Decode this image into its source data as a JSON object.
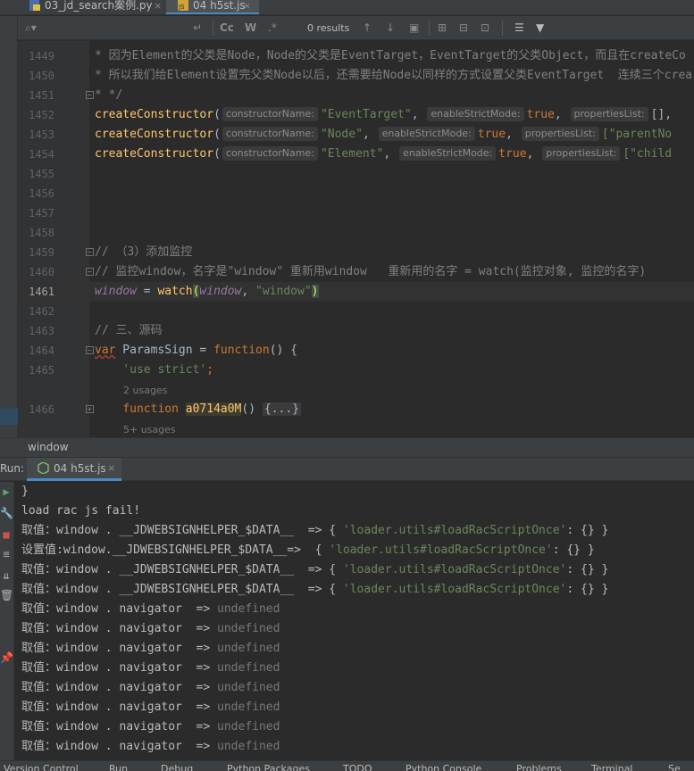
{
  "tabs": [
    {
      "label": "03_jd_search案例.py",
      "icon": "python-file-icon"
    },
    {
      "label": "04 h5st.js",
      "icon": "js-file-icon",
      "active": true
    }
  ],
  "search": {
    "placeholder": "",
    "results": "0 results",
    "match_case": "Cc",
    "words": "W",
    "regex": ".*"
  },
  "editor": {
    "lines": [
      {
        "num": "1449",
        "segments": [
          {
            "t": "* 因为Element的父类是Node，Node的父类是EventTarget，EventTarget的父类Object，而且在createCo",
            "c": "comment"
          }
        ]
      },
      {
        "num": "1450",
        "segments": [
          {
            "t": "* 所以我们给Element设置完父类Node以后，还需要给Node以同样的方式设置父类EventTarget  连续三个crea",
            "c": "comment"
          }
        ]
      },
      {
        "num": "1451",
        "segments": [
          {
            "t": "* */",
            "c": "comment"
          }
        ]
      },
      {
        "num": "1452",
        "segments": [
          {
            "t": "createConstructor",
            "c": "fn"
          },
          {
            "t": "(",
            "c": ""
          },
          {
            "hint": "constructorName:"
          },
          {
            "t": "\"EventTarget\"",
            "c": "str"
          },
          {
            "t": ", ",
            "c": ""
          },
          {
            "hint": "enableStrictMode:"
          },
          {
            "t": "true",
            "c": "kw"
          },
          {
            "t": ", ",
            "c": ""
          },
          {
            "hint": "propertiesList:"
          },
          {
            "t": "[],",
            "c": ""
          }
        ]
      },
      {
        "num": "1453",
        "segments": [
          {
            "t": "createConstructor",
            "c": "fn"
          },
          {
            "t": "(",
            "c": ""
          },
          {
            "hint": "constructorName:"
          },
          {
            "t": "\"Node\"",
            "c": "str"
          },
          {
            "t": ", ",
            "c": ""
          },
          {
            "hint": "enableStrictMode:"
          },
          {
            "t": "true",
            "c": "kw"
          },
          {
            "t": ", ",
            "c": ""
          },
          {
            "hint": "propertiesList:"
          },
          {
            "t": "[\"parentNo",
            "c": "str"
          }
        ]
      },
      {
        "num": "1454",
        "segments": [
          {
            "t": "createConstructor",
            "c": "fn"
          },
          {
            "t": "(",
            "c": ""
          },
          {
            "hint": "constructorName:"
          },
          {
            "t": "\"Element\"",
            "c": "str"
          },
          {
            "t": ", ",
            "c": ""
          },
          {
            "hint": "enableStrictMode:"
          },
          {
            "t": "true",
            "c": "kw"
          },
          {
            "t": ", ",
            "c": ""
          },
          {
            "hint": "propertiesList:"
          },
          {
            "t": "[\"child",
            "c": "str"
          }
        ]
      },
      {
        "num": "1455",
        "segments": []
      },
      {
        "num": "1456",
        "segments": []
      },
      {
        "num": "1457",
        "segments": []
      },
      {
        "num": "1458",
        "segments": []
      },
      {
        "num": "1459",
        "segments": [
          {
            "t": "// （3）添加监控",
            "c": "comment"
          }
        ]
      },
      {
        "num": "1460",
        "segments": [
          {
            "t": "// 监控window，名字是\"window\" 重新用window   重新用的名字 = watch(监控对象, 监控的名字)",
            "c": "comment"
          }
        ]
      },
      {
        "num": "1461",
        "segments": [
          {
            "t": "window",
            "c": "glob"
          },
          {
            "t": " = ",
            "c": ""
          },
          {
            "t": "watch",
            "c": "fn"
          },
          {
            "t": "(",
            "c": "paren"
          },
          {
            "t": "window",
            "c": "glob"
          },
          {
            "t": ", ",
            "c": ""
          },
          {
            "t": "\"window\"",
            "c": "str"
          },
          {
            "t": ")",
            "c": "paren"
          }
        ],
        "current": true
      },
      {
        "num": "1462",
        "segments": []
      },
      {
        "num": "1463",
        "segments": [
          {
            "t": "// 三、源码",
            "c": "comment"
          }
        ]
      },
      {
        "num": "1464",
        "segments": [
          {
            "t": "var",
            "c": "kwwavy"
          },
          {
            "t": " ParamsSign = ",
            "c": ""
          },
          {
            "t": "function",
            "c": "kw"
          },
          {
            "t": "() {",
            "c": ""
          }
        ]
      },
      {
        "num": "1465",
        "segments": [
          {
            "t": "    'use strict'",
            "c": "str"
          },
          {
            "t": ";",
            "c": "kw"
          }
        ]
      },
      {
        "num": "1466",
        "segments": [
          {
            "t": "    ",
            "c": ""
          },
          {
            "t": "function",
            "c": "kw"
          },
          {
            "t": " ",
            "c": ""
          },
          {
            "t": "a0714a0M",
            "c": "fnhl"
          },
          {
            "t": "() ",
            "c": ""
          },
          {
            "t": "{...}",
            "c": "folded"
          }
        ]
      }
    ],
    "usages_1": "2 usages",
    "usages_2": "5+ usages"
  },
  "breadcrumb": "window",
  "run": {
    "label": "Run:",
    "tab": "04 h5st.js"
  },
  "console": [
    {
      "parts": [
        {
          "t": "}"
        }
      ]
    },
    {
      "parts": [
        {
          "t": "load rac js fail!"
        }
      ]
    },
    {
      "parts": [
        {
          "t": "取值：window . __JDWEBSIGNHELPER_$DATA__  => { "
        },
        {
          "t": "'loader.utils#loadRacScriptOnce'",
          "c": "str"
        },
        {
          "t": ": {} }"
        }
      ]
    },
    {
      "parts": [
        {
          "t": "设置值:window.__JDWEBSIGNHELPER_$DATA__=>  { "
        },
        {
          "t": "'loader.utils#loadRacScriptOnce'",
          "c": "str"
        },
        {
          "t": ": {} }"
        }
      ]
    },
    {
      "parts": [
        {
          "t": "取值：window . __JDWEBSIGNHELPER_$DATA__  => { "
        },
        {
          "t": "'loader.utils#loadRacScriptOnce'",
          "c": "str"
        },
        {
          "t": ": {} }"
        }
      ]
    },
    {
      "parts": [
        {
          "t": "取值：window . __JDWEBSIGNHELPER_$DATA__  => { "
        },
        {
          "t": "'loader.utils#loadRacScriptOnce'",
          "c": "str"
        },
        {
          "t": ": {} }"
        }
      ]
    },
    {
      "parts": [
        {
          "t": "取值：window . navigator  => "
        },
        {
          "t": "undefined",
          "c": "undef"
        }
      ]
    },
    {
      "parts": [
        {
          "t": "取值：window . navigator  => "
        },
        {
          "t": "undefined",
          "c": "undef"
        }
      ]
    },
    {
      "parts": [
        {
          "t": "取值：window . navigator  => "
        },
        {
          "t": "undefined",
          "c": "undef"
        }
      ]
    },
    {
      "parts": [
        {
          "t": "取值：window . navigator  => "
        },
        {
          "t": "undefined",
          "c": "undef"
        }
      ]
    },
    {
      "parts": [
        {
          "t": "取值：window . navigator  => "
        },
        {
          "t": "undefined",
          "c": "undef"
        }
      ]
    },
    {
      "parts": [
        {
          "t": "取值：window . navigator  => "
        },
        {
          "t": "undefined",
          "c": "undef"
        }
      ]
    },
    {
      "parts": [
        {
          "t": "取值：window . navigator  => "
        },
        {
          "t": "undefined",
          "c": "undef"
        }
      ]
    },
    {
      "parts": [
        {
          "t": "取值：window . navigator  => "
        },
        {
          "t": "undefined",
          "c": "undef"
        }
      ]
    }
  ],
  "statusbar": [
    "Version Control",
    "Run",
    "Debug",
    "Python Packages",
    "TODO",
    "Python Console",
    "Problems",
    "Terminal",
    "Se"
  ],
  "colors": {
    "accent": "#4a88c7",
    "string": "#6a8759",
    "keyword": "#cc7832",
    "function": "#ffc66d",
    "comment": "#808080"
  }
}
